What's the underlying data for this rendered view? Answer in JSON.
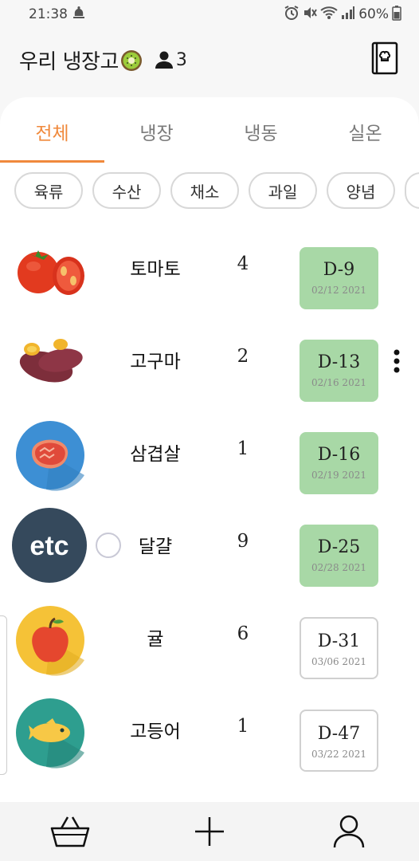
{
  "status_bar": {
    "time": "21:38",
    "battery": "60%"
  },
  "header": {
    "title": "우리 냉장고",
    "member_count": "3"
  },
  "tabs": [
    {
      "label": "전체",
      "active": true
    },
    {
      "label": "냉장",
      "active": false
    },
    {
      "label": "냉동",
      "active": false
    },
    {
      "label": "실온",
      "active": false
    }
  ],
  "categories": [
    "육류",
    "수산",
    "채소",
    "과일",
    "양념"
  ],
  "items": [
    {
      "name": "토마토",
      "qty": "4",
      "dday": "D-9",
      "date": "02/12 2021",
      "style": "green",
      "icon": "tomato-icon"
    },
    {
      "name": "고구마",
      "qty": "2",
      "dday": "D-13",
      "date": "02/16 2021",
      "style": "green",
      "icon": "sweet-potato-icon"
    },
    {
      "name": "삼겹살",
      "qty": "1",
      "dday": "D-16",
      "date": "02/19 2021",
      "style": "green",
      "icon": "meat-icon"
    },
    {
      "name": "달걀",
      "qty": "9",
      "dday": "D-25",
      "date": "02/28 2021",
      "style": "green",
      "icon": "etc-icon"
    },
    {
      "name": "귤",
      "qty": "6",
      "dday": "D-31",
      "date": "03/06 2021",
      "style": "outline",
      "icon": "fruit-icon"
    },
    {
      "name": "고등어",
      "qty": "1",
      "dday": "D-47",
      "date": "03/22 2021",
      "style": "outline",
      "icon": "fish-icon"
    }
  ],
  "etc_label": "etc",
  "colors": {
    "accent": "#f0893c",
    "dday_green": "#a8d8a6"
  },
  "bottom_nav": [
    "basket-icon",
    "add-icon",
    "profile-icon"
  ]
}
